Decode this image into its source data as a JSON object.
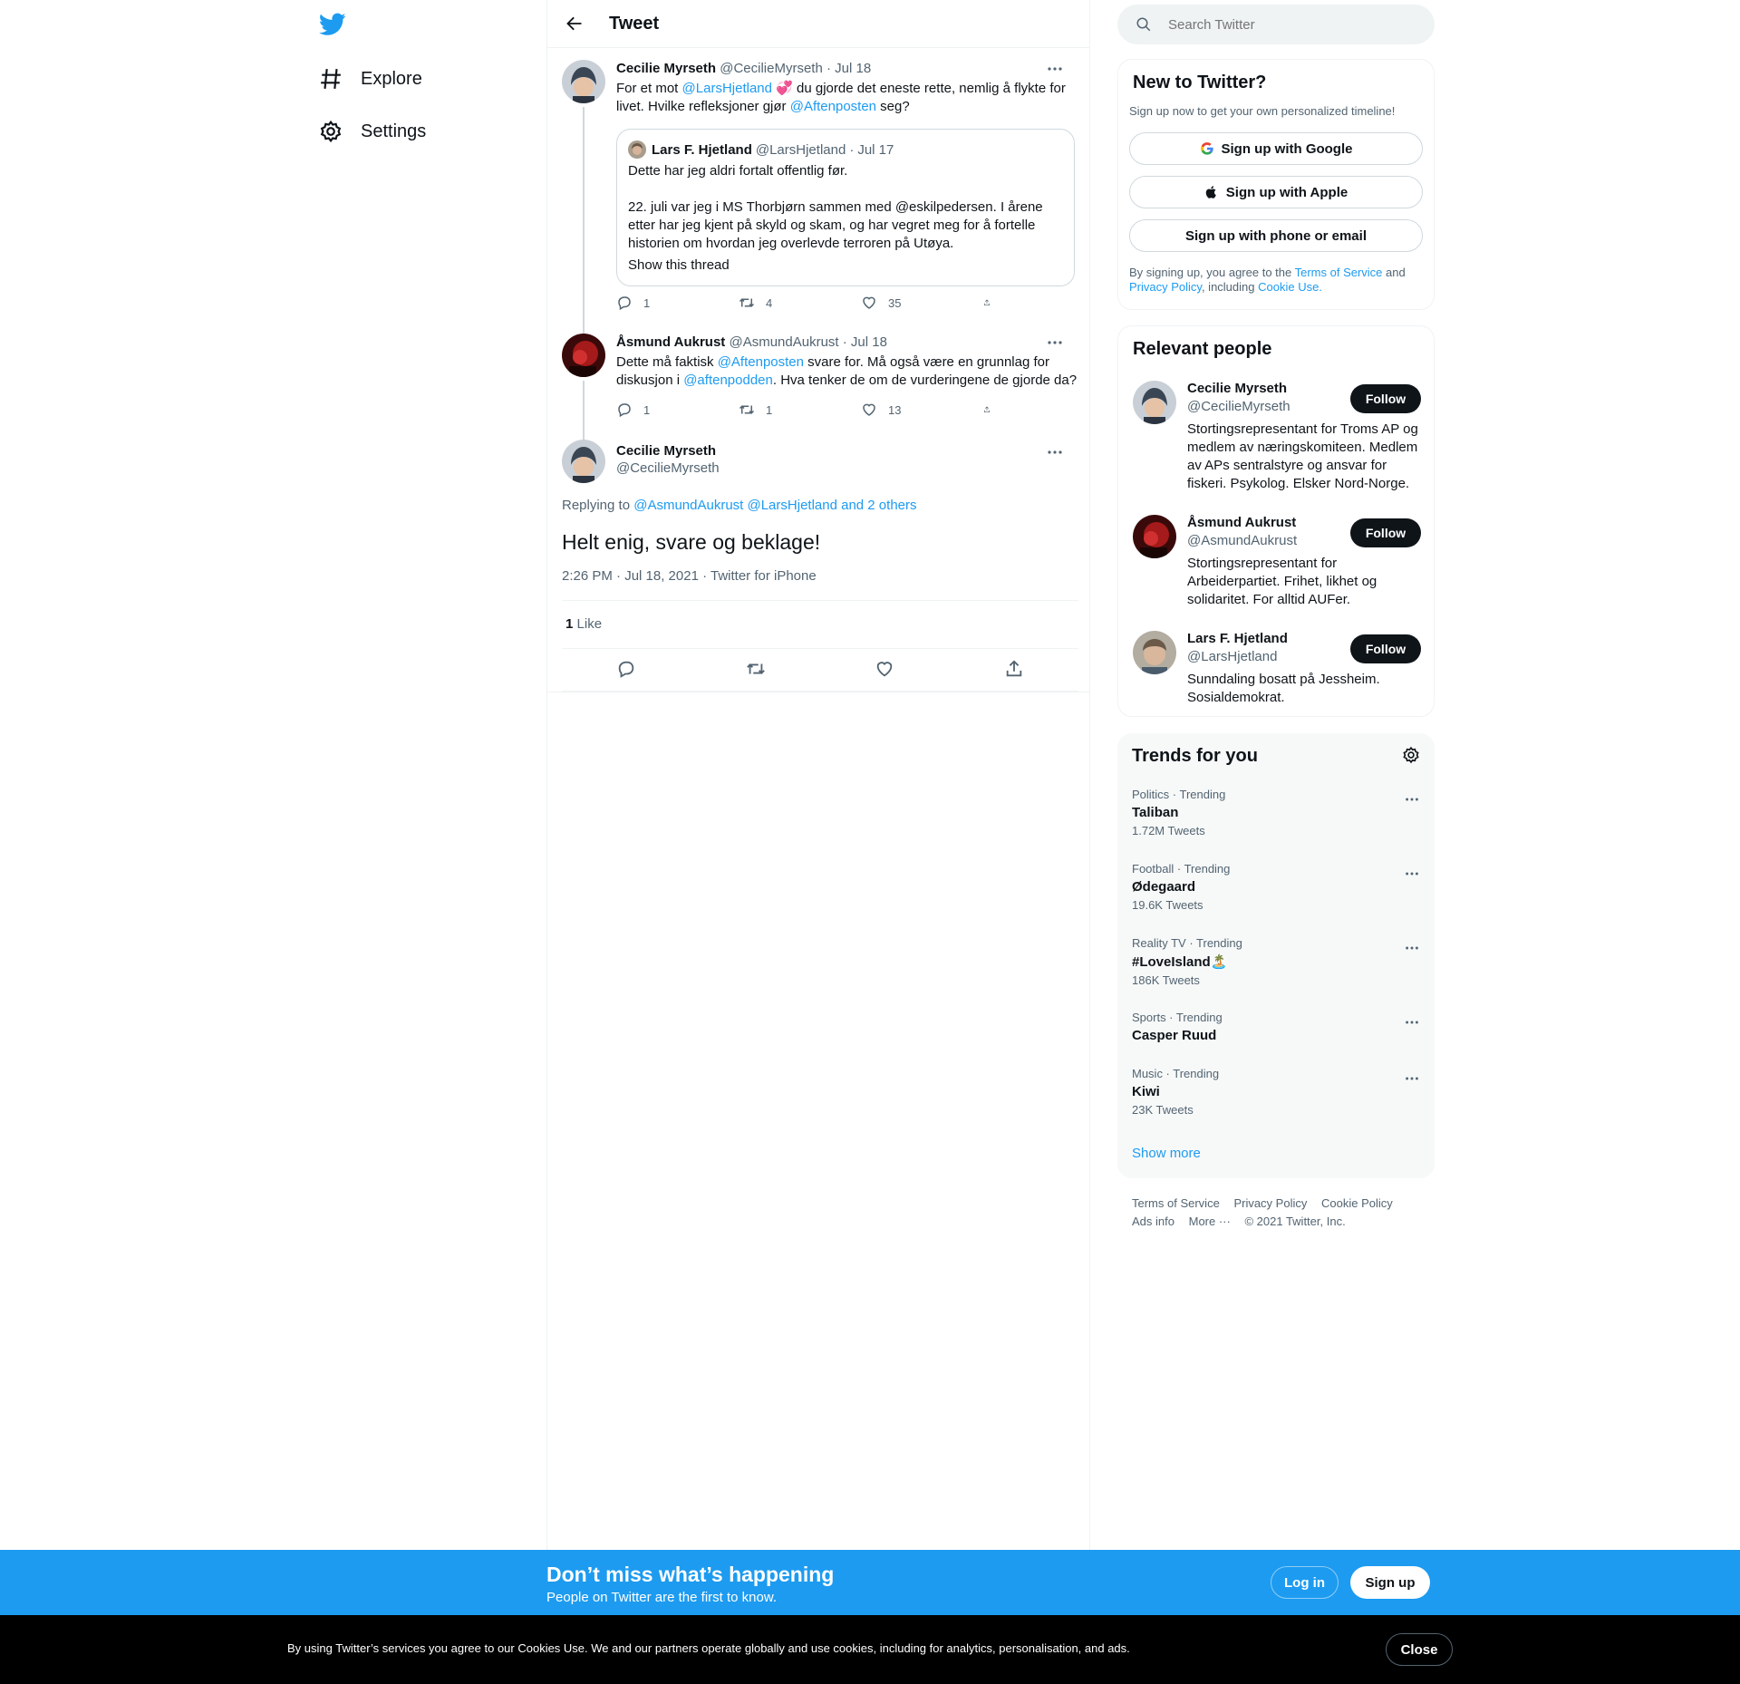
{
  "nav": {
    "explore": "Explore",
    "settings": "Settings"
  },
  "header": {
    "title": "Tweet"
  },
  "thread": [
    {
      "name": "Cecilie Myrseth",
      "handle": "@CecilieMyrseth",
      "date": "Jul 18",
      "text_parts": [
        "For et mot ",
        "@LarsHjetland",
        " 💞 du gjorde det eneste rette, nemlig å flykte for livet. Hvilke refleksjoner gjør  ",
        "@Aftenposten",
        " seg?"
      ],
      "quote": {
        "name": "Lars F. Hjetland",
        "handle": "@LarsHjetland",
        "date": "Jul 17",
        "line1": "Dette har jeg aldri fortalt offentlig før.",
        "line2": "22. juli var jeg i MS Thorbjørn sammen med @eskilpedersen. I årene etter har jeg kjent på skyld og skam, og har vegret meg for å fortelle historien om hvordan jeg overlevde terroren på Utøya.",
        "show_thread": "Show this thread"
      },
      "replies": "1",
      "retweets": "4",
      "likes": "35"
    },
    {
      "name": "Åsmund Aukrust",
      "handle": "@AsmundAukrust",
      "date": "Jul 18",
      "text_parts": [
        "Dette må faktisk ",
        "@Aftenposten",
        " svare for. Må også være en grunnlag for diskusjon i ",
        "@aftenpodden",
        ". Hva tenker de om de vurderingene de gjorde da?"
      ],
      "replies": "1",
      "retweets": "1",
      "likes": "13"
    }
  ],
  "main": {
    "name": "Cecilie Myrseth",
    "handle": "@CecilieMyrseth",
    "replying_label": "Replying to ",
    "replying_to": "@AsmundAukrust @LarsHjetland and 2 others",
    "text": "Helt enig, svare og beklage!",
    "meta": "2:26 PM · Jul 18, 2021 · Twitter for iPhone",
    "like_count": "1",
    "like_label": "Like"
  },
  "search": {
    "placeholder": "Search Twitter"
  },
  "new_to_twitter": {
    "title": "New to Twitter?",
    "subtitle": "Sign up now to get your own personalized timeline!",
    "google": "Sign up with Google",
    "apple": "Sign up with Apple",
    "phone": "Sign up with phone or email",
    "legal_1": "By signing up, you agree to the ",
    "terms": "Terms of Service",
    "legal_2": " and ",
    "privacy": "Privacy Policy",
    "legal_3": ", including ",
    "cookie": "Cookie Use."
  },
  "relevant": {
    "title": "Relevant people",
    "follow_label": "Follow",
    "people": [
      {
        "name": "Cecilie Myrseth",
        "handle": "@CecilieMyrseth",
        "bio": "Stortingsrepresentant for Troms AP og medlem av næringskomiteen. Medlem av APs sentralstyre og ansvar for fiskeri. Psykolog. Elsker Nord-Norge."
      },
      {
        "name": "Åsmund Aukrust",
        "handle": "@AsmundAukrust",
        "bio": "Stortingsrepresentant for Arbeiderpartiet. Frihet, likhet og solidaritet. For alltid AUFer."
      },
      {
        "name": "Lars F. Hjetland",
        "handle": "@LarsHjetland",
        "bio": "Sunndaling bosatt på Jessheim. Sosialdemokrat."
      }
    ]
  },
  "trends": {
    "title": "Trends for you",
    "items": [
      {
        "category": "Politics · Trending",
        "name": "Taliban",
        "count": "1.72M Tweets"
      },
      {
        "category": "Football · Trending",
        "name": "Ødegaard",
        "count": "19.6K Tweets"
      },
      {
        "category": "Reality TV · Trending",
        "name": "#LoveIsland🏝️",
        "count": "186K Tweets"
      },
      {
        "category": "Sports · Trending",
        "name": "Casper Ruud",
        "count": ""
      },
      {
        "category": "Music · Trending",
        "name": "Kiwi",
        "count": "23K Tweets"
      }
    ],
    "show_more": "Show more"
  },
  "footer": {
    "terms": "Terms of Service",
    "privacy": "Privacy Policy",
    "cookie": "Cookie Policy",
    "ads": "Ads info",
    "more": "More ···",
    "copyright": "© 2021 Twitter, Inc."
  },
  "banner": {
    "headline": "Don’t miss what’s happening",
    "sub": "People on Twitter are the first to know.",
    "login": "Log in",
    "signup": "Sign up"
  },
  "cookies": {
    "text": "By using Twitter’s services you agree to our Cookies Use. We and our partners operate globally and use cookies, including for analytics, personalisation, and ads.",
    "close": "Close"
  },
  "colors": {
    "accent": "#1d9bf0",
    "text": "#0f1419",
    "muted": "#536471",
    "border": "#eff3f4"
  }
}
